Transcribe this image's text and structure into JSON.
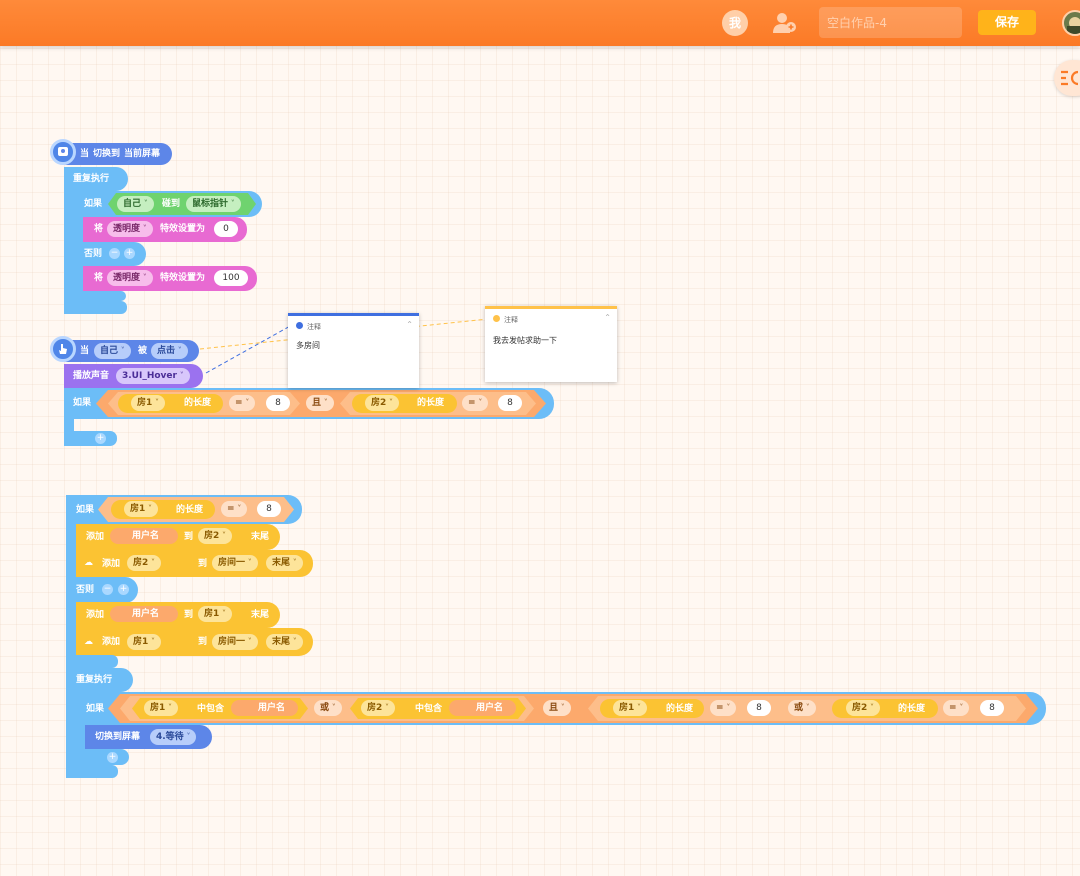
{
  "topbar": {
    "me_label": "我",
    "title_placeholder": "空白作品-4",
    "save_label": "保存"
  },
  "colors": {
    "topbar": "#fb7a26",
    "save": "#ffb31a",
    "control": "#6cbdf7",
    "looks": "#e86ad2",
    "sound": "#9b72ef",
    "event": "#5d86e8",
    "sensing": "#6fd36f",
    "list": "#fbc333",
    "operator": "#fca96c"
  },
  "script1": {
    "hat_when": "当",
    "hat_switch": "切换到",
    "hat_screen": "当前屏幕",
    "repeat": "重复执行",
    "if": "如果",
    "self": "自己",
    "touch": "碰到",
    "mouse": "鼠标指针",
    "set_prefix": "将",
    "opacity": "透明度",
    "effect_set": "特效设置为",
    "value_then": "0",
    "else": "否则",
    "minus": "−",
    "plus": "+",
    "value_else": "100"
  },
  "script2": {
    "when": "当",
    "self": "自己",
    "by": "被",
    "click": "点击",
    "play_sound": "播放声音",
    "sound_name": "3.UI_Hover",
    "if": "如果",
    "room1": "房1",
    "length_of": "的长度",
    "eq": "=",
    "val1": "8",
    "and": "且",
    "room2": "房2",
    "val2": "8",
    "plus": "+"
  },
  "notes": [
    {
      "header": "注释",
      "body": "多房间"
    },
    {
      "header": "注释",
      "body": "我去发帖求助一下"
    }
  ],
  "script3": {
    "if": "如果",
    "room1": "房1",
    "length_of": "的长度",
    "eq": "=",
    "val": "8",
    "add": "添加",
    "username": "用户名",
    "to": "到",
    "room2": "房2",
    "end": "末尾",
    "room_one": "房间一",
    "else": "否则",
    "minus": "−",
    "plus": "+",
    "repeat": "重复执行",
    "contains": "中包含",
    "or": "或",
    "and": "且",
    "val_r1": "8",
    "val_r2": "8",
    "switch_screen": "切换到屏幕",
    "screen_name": "4.等待"
  }
}
